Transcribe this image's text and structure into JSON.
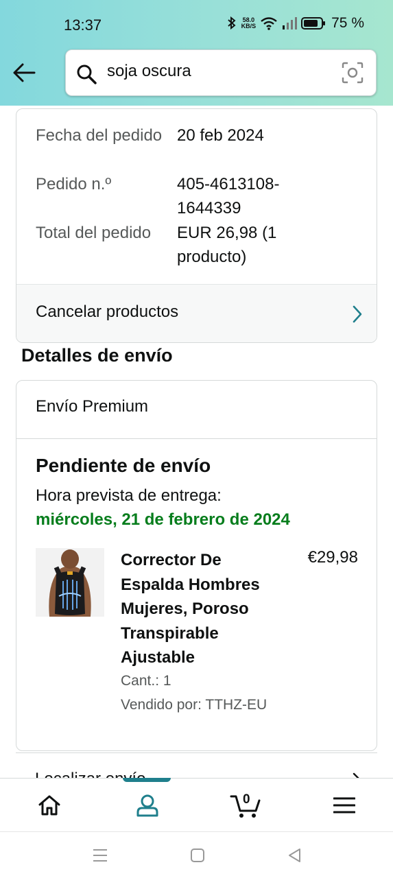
{
  "status_bar": {
    "time": "13:37",
    "network_speed": "58.0",
    "network_unit": "KB/S",
    "battery": "75 %"
  },
  "search": {
    "query": "soja oscura"
  },
  "order": {
    "rows": [
      {
        "label": "Fecha del pedido",
        "value": "20 feb 2024"
      },
      {
        "label": "Pedido n.º",
        "value": "405-4613108-1644339"
      },
      {
        "label": "Total del pedido",
        "value": "EUR 26,98 (1 producto)"
      }
    ],
    "cancel_label": "Cancelar productos"
  },
  "shipping": {
    "section_title": "Detalles de envío",
    "type": "Envío Premium",
    "status": "Pendiente de envío",
    "eta_label": "Hora prevista de entrega:",
    "eta_date": "miércoles, 21 de febrero de 2024",
    "product": {
      "title": "Corrector De Espalda Hombres Mujeres, Poroso Transpirable Ajustable",
      "price": "€29,98",
      "qty": "Cant.: 1",
      "seller": "Vendido por: TTHZ-EU"
    },
    "track_label": "Localizar envío"
  },
  "bottom_nav": {
    "cart_count": "0",
    "items": [
      "home",
      "account",
      "cart",
      "menu"
    ],
    "active": "account"
  },
  "colors": {
    "header_gradient_start": "#83d8dd",
    "header_gradient_end": "#a6e6cf",
    "delivery_green": "#067d1c",
    "accent_teal": "#1f7f8c"
  }
}
